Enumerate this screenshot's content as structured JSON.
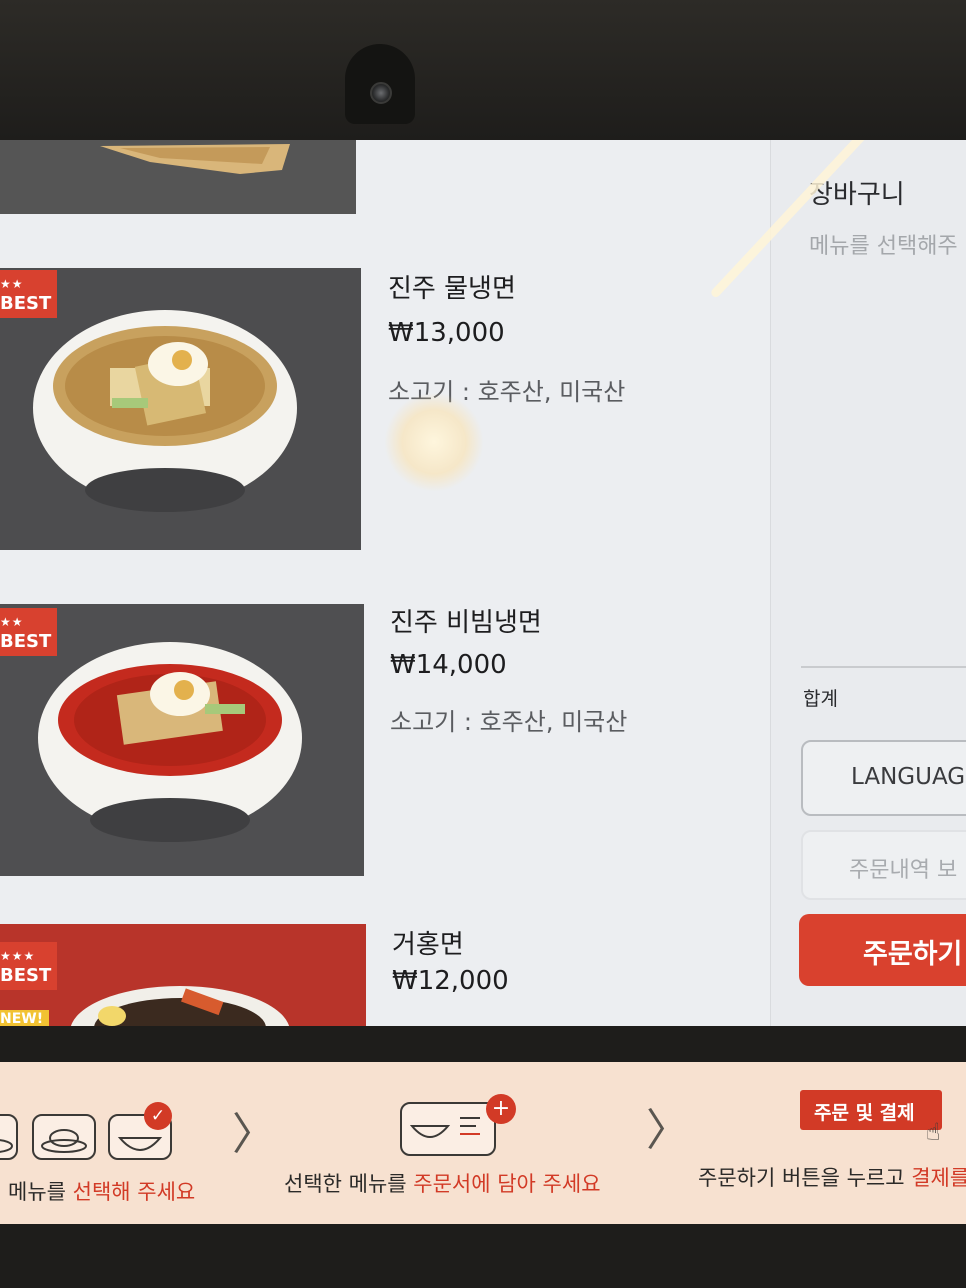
{
  "menu": {
    "items": [
      {
        "name": "진주 물냉면",
        "price": "₩13,000",
        "origin": "소고기 : 호주산, 미국산",
        "badge": "BEST",
        "badge_stars": "★★"
      },
      {
        "name": "진주 비빔냉면",
        "price": "₩14,000",
        "origin": "소고기 : 호주산, 미국산",
        "badge": "BEST",
        "badge_stars": "★★"
      },
      {
        "name": "거홍면",
        "price": "₩12,000",
        "badge": "BEST",
        "badge_stars": "★★★",
        "extra_badge": "NEW!"
      }
    ]
  },
  "cart": {
    "title": "장바구니",
    "empty_text": "메뉴를 선택해주",
    "total_label": "합계",
    "language_button": "LANGUAG",
    "history_button": "주문내역 보",
    "order_button": "주문하기"
  },
  "instructions": {
    "step1_prefix": "메뉴를 ",
    "step1_highlight": "선택해 주세요",
    "step2_prefix": "선택한 메뉴를 ",
    "step2_highlight": "주문서에 담아 주세요",
    "step3_prefix": "주문하기 버튼을 누르고 ",
    "step3_highlight": "결제를",
    "step3_chip": "주문 및 결제"
  },
  "colors": {
    "accent_red": "#d9412e",
    "instruction_bg": "#f7e1d0",
    "screen_bg": "#eceef1"
  }
}
